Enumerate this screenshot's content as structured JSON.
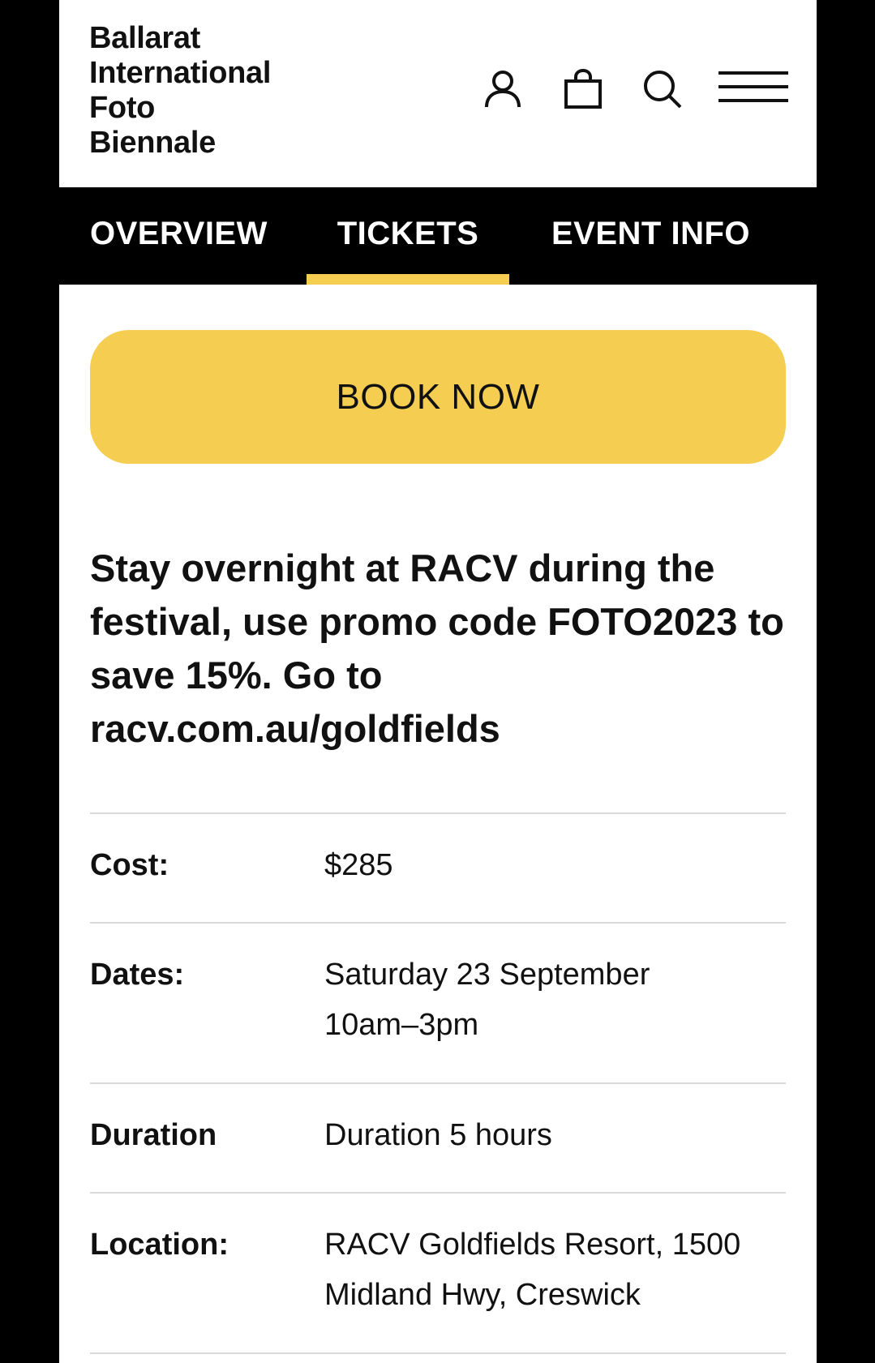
{
  "header": {
    "logo_lines": [
      "Ballarat",
      "International",
      "Foto",
      "Biennale"
    ],
    "icons": [
      "account-icon",
      "bag-icon",
      "search-icon",
      "menu-icon"
    ]
  },
  "tabs": [
    {
      "label": "OVERVIEW",
      "active": false
    },
    {
      "label": "TICKETS",
      "active": true
    },
    {
      "label": "EVENT INFO",
      "active": false
    }
  ],
  "book_button": {
    "label": "BOOK NOW"
  },
  "promo": {
    "text": "Stay overnight at RACV during the festival, use promo code FOTO2023 to save 15%. Go to racv.com.au/goldfields"
  },
  "details": {
    "cost": {
      "label": "Cost:",
      "value": "$285"
    },
    "dates": {
      "label": "Dates:",
      "value_line1": "Saturday 23 September",
      "value_line2": "10am–3pm"
    },
    "duration": {
      "label": "Duration",
      "value": "Duration 5 hours"
    },
    "location": {
      "label": "Location:",
      "value_line1": "RACV Goldfields Resort, 1500",
      "value_line2": "Midland Hwy, Creswick"
    }
  },
  "colors": {
    "accent": "#f5cd50",
    "background": "#ffffff",
    "frame": "#000000",
    "text": "#111111",
    "divider": "#d9d9d9"
  }
}
